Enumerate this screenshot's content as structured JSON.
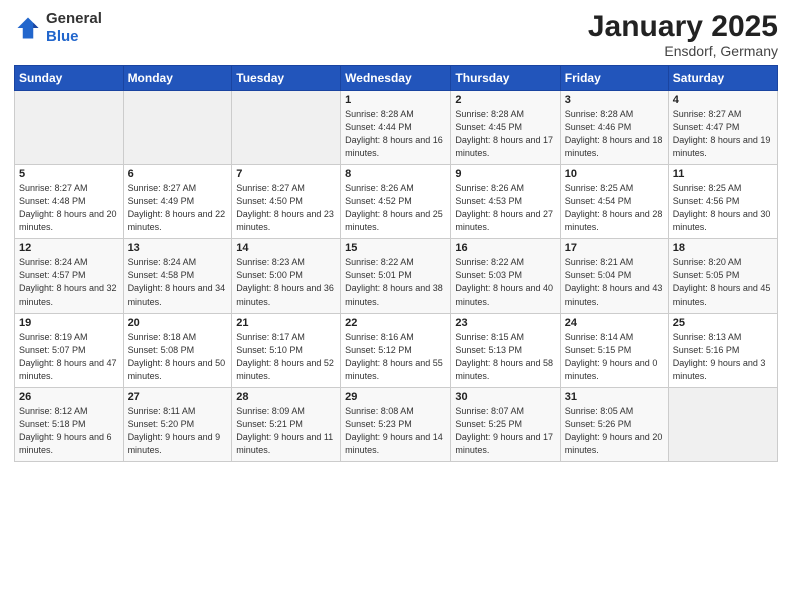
{
  "header": {
    "logo_general": "General",
    "logo_blue": "Blue",
    "month_title": "January 2025",
    "location": "Ensdorf, Germany"
  },
  "days_of_week": [
    "Sunday",
    "Monday",
    "Tuesday",
    "Wednesday",
    "Thursday",
    "Friday",
    "Saturday"
  ],
  "weeks": [
    [
      {
        "num": "",
        "sunrise": "",
        "sunset": "",
        "daylight": "",
        "empty": true
      },
      {
        "num": "",
        "sunrise": "",
        "sunset": "",
        "daylight": "",
        "empty": true
      },
      {
        "num": "",
        "sunrise": "",
        "sunset": "",
        "daylight": "",
        "empty": true
      },
      {
        "num": "1",
        "sunrise": "Sunrise: 8:28 AM",
        "sunset": "Sunset: 4:44 PM",
        "daylight": "Daylight: 8 hours and 16 minutes."
      },
      {
        "num": "2",
        "sunrise": "Sunrise: 8:28 AM",
        "sunset": "Sunset: 4:45 PM",
        "daylight": "Daylight: 8 hours and 17 minutes."
      },
      {
        "num": "3",
        "sunrise": "Sunrise: 8:28 AM",
        "sunset": "Sunset: 4:46 PM",
        "daylight": "Daylight: 8 hours and 18 minutes."
      },
      {
        "num": "4",
        "sunrise": "Sunrise: 8:27 AM",
        "sunset": "Sunset: 4:47 PM",
        "daylight": "Daylight: 8 hours and 19 minutes."
      }
    ],
    [
      {
        "num": "5",
        "sunrise": "Sunrise: 8:27 AM",
        "sunset": "Sunset: 4:48 PM",
        "daylight": "Daylight: 8 hours and 20 minutes."
      },
      {
        "num": "6",
        "sunrise": "Sunrise: 8:27 AM",
        "sunset": "Sunset: 4:49 PM",
        "daylight": "Daylight: 8 hours and 22 minutes."
      },
      {
        "num": "7",
        "sunrise": "Sunrise: 8:27 AM",
        "sunset": "Sunset: 4:50 PM",
        "daylight": "Daylight: 8 hours and 23 minutes."
      },
      {
        "num": "8",
        "sunrise": "Sunrise: 8:26 AM",
        "sunset": "Sunset: 4:52 PM",
        "daylight": "Daylight: 8 hours and 25 minutes."
      },
      {
        "num": "9",
        "sunrise": "Sunrise: 8:26 AM",
        "sunset": "Sunset: 4:53 PM",
        "daylight": "Daylight: 8 hours and 27 minutes."
      },
      {
        "num": "10",
        "sunrise": "Sunrise: 8:25 AM",
        "sunset": "Sunset: 4:54 PM",
        "daylight": "Daylight: 8 hours and 28 minutes."
      },
      {
        "num": "11",
        "sunrise": "Sunrise: 8:25 AM",
        "sunset": "Sunset: 4:56 PM",
        "daylight": "Daylight: 8 hours and 30 minutes."
      }
    ],
    [
      {
        "num": "12",
        "sunrise": "Sunrise: 8:24 AM",
        "sunset": "Sunset: 4:57 PM",
        "daylight": "Daylight: 8 hours and 32 minutes."
      },
      {
        "num": "13",
        "sunrise": "Sunrise: 8:24 AM",
        "sunset": "Sunset: 4:58 PM",
        "daylight": "Daylight: 8 hours and 34 minutes."
      },
      {
        "num": "14",
        "sunrise": "Sunrise: 8:23 AM",
        "sunset": "Sunset: 5:00 PM",
        "daylight": "Daylight: 8 hours and 36 minutes."
      },
      {
        "num": "15",
        "sunrise": "Sunrise: 8:22 AM",
        "sunset": "Sunset: 5:01 PM",
        "daylight": "Daylight: 8 hours and 38 minutes."
      },
      {
        "num": "16",
        "sunrise": "Sunrise: 8:22 AM",
        "sunset": "Sunset: 5:03 PM",
        "daylight": "Daylight: 8 hours and 40 minutes."
      },
      {
        "num": "17",
        "sunrise": "Sunrise: 8:21 AM",
        "sunset": "Sunset: 5:04 PM",
        "daylight": "Daylight: 8 hours and 43 minutes."
      },
      {
        "num": "18",
        "sunrise": "Sunrise: 8:20 AM",
        "sunset": "Sunset: 5:05 PM",
        "daylight": "Daylight: 8 hours and 45 minutes."
      }
    ],
    [
      {
        "num": "19",
        "sunrise": "Sunrise: 8:19 AM",
        "sunset": "Sunset: 5:07 PM",
        "daylight": "Daylight: 8 hours and 47 minutes."
      },
      {
        "num": "20",
        "sunrise": "Sunrise: 8:18 AM",
        "sunset": "Sunset: 5:08 PM",
        "daylight": "Daylight: 8 hours and 50 minutes."
      },
      {
        "num": "21",
        "sunrise": "Sunrise: 8:17 AM",
        "sunset": "Sunset: 5:10 PM",
        "daylight": "Daylight: 8 hours and 52 minutes."
      },
      {
        "num": "22",
        "sunrise": "Sunrise: 8:16 AM",
        "sunset": "Sunset: 5:12 PM",
        "daylight": "Daylight: 8 hours and 55 minutes."
      },
      {
        "num": "23",
        "sunrise": "Sunrise: 8:15 AM",
        "sunset": "Sunset: 5:13 PM",
        "daylight": "Daylight: 8 hours and 58 minutes."
      },
      {
        "num": "24",
        "sunrise": "Sunrise: 8:14 AM",
        "sunset": "Sunset: 5:15 PM",
        "daylight": "Daylight: 9 hours and 0 minutes."
      },
      {
        "num": "25",
        "sunrise": "Sunrise: 8:13 AM",
        "sunset": "Sunset: 5:16 PM",
        "daylight": "Daylight: 9 hours and 3 minutes."
      }
    ],
    [
      {
        "num": "26",
        "sunrise": "Sunrise: 8:12 AM",
        "sunset": "Sunset: 5:18 PM",
        "daylight": "Daylight: 9 hours and 6 minutes."
      },
      {
        "num": "27",
        "sunrise": "Sunrise: 8:11 AM",
        "sunset": "Sunset: 5:20 PM",
        "daylight": "Daylight: 9 hours and 9 minutes."
      },
      {
        "num": "28",
        "sunrise": "Sunrise: 8:09 AM",
        "sunset": "Sunset: 5:21 PM",
        "daylight": "Daylight: 9 hours and 11 minutes."
      },
      {
        "num": "29",
        "sunrise": "Sunrise: 8:08 AM",
        "sunset": "Sunset: 5:23 PM",
        "daylight": "Daylight: 9 hours and 14 minutes."
      },
      {
        "num": "30",
        "sunrise": "Sunrise: 8:07 AM",
        "sunset": "Sunset: 5:25 PM",
        "daylight": "Daylight: 9 hours and 17 minutes."
      },
      {
        "num": "31",
        "sunrise": "Sunrise: 8:05 AM",
        "sunset": "Sunset: 5:26 PM",
        "daylight": "Daylight: 9 hours and 20 minutes."
      },
      {
        "num": "",
        "sunrise": "",
        "sunset": "",
        "daylight": "",
        "empty": true
      }
    ]
  ]
}
